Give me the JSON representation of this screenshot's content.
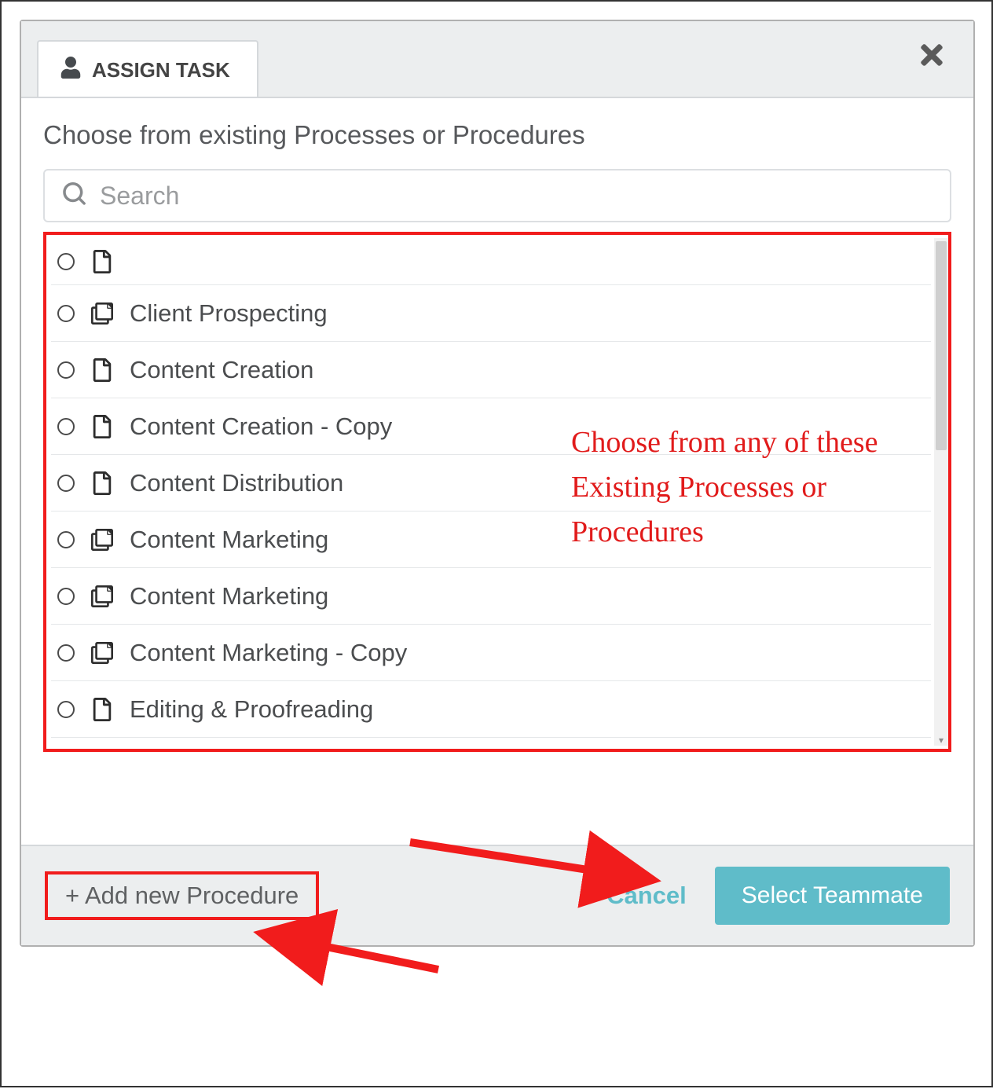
{
  "colors": {
    "accent": "#5fbcc9",
    "highlight": "#f11c1c"
  },
  "header": {
    "tab_label": "ASSIGN TASK"
  },
  "body": {
    "prompt": "Choose from existing Processes or Procedures",
    "search_placeholder": "Search"
  },
  "list": [
    {
      "icon": "doc",
      "label": ""
    },
    {
      "icon": "stack",
      "label": "Client Prospecting"
    },
    {
      "icon": "doc",
      "label": "Content Creation"
    },
    {
      "icon": "doc",
      "label": "Content Creation - Copy"
    },
    {
      "icon": "doc",
      "label": "Content Distribution"
    },
    {
      "icon": "stack",
      "label": "Content Marketing"
    },
    {
      "icon": "stack",
      "label": "Content Marketing"
    },
    {
      "icon": "stack",
      "label": "Content Marketing - Copy"
    },
    {
      "icon": "doc",
      "label": "Editing & Proofreading"
    }
  ],
  "annotation": "Choose from any of these Existing Processes or Procedures",
  "footer": {
    "add_label": "+ Add new Procedure",
    "cancel_label": "Cancel",
    "select_label": "Select Teammate"
  }
}
